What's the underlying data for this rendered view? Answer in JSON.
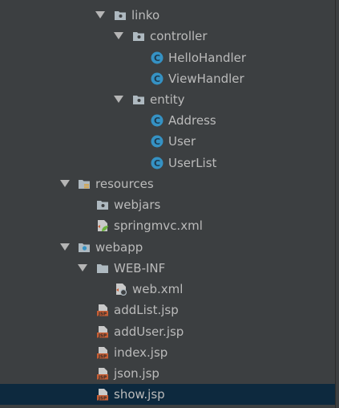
{
  "colors": {
    "background": "#3c3f41",
    "selection": "#0d293e",
    "text": "#bbbbbb",
    "class_icon": "#3592c4",
    "jsp_icon": "#c75e35"
  },
  "tree": {
    "linko": {
      "label": "linko",
      "icon": "package-folder-icon"
    },
    "controller": {
      "label": "controller",
      "icon": "package-folder-icon"
    },
    "hello_handler": {
      "label": "HelloHandler",
      "icon": "class-icon",
      "glyph": "C"
    },
    "view_handler": {
      "label": "ViewHandler",
      "icon": "class-icon",
      "glyph": "C"
    },
    "entity": {
      "label": "entity",
      "icon": "package-folder-icon"
    },
    "address": {
      "label": "Address",
      "icon": "class-icon",
      "glyph": "C"
    },
    "user": {
      "label": "User",
      "icon": "class-icon",
      "glyph": "C"
    },
    "user_list": {
      "label": "UserList",
      "icon": "class-icon",
      "glyph": "C"
    },
    "resources": {
      "label": "resources",
      "icon": "resources-folder-icon"
    },
    "webjars": {
      "label": "webjars",
      "icon": "package-folder-icon"
    },
    "springmvc_xml": {
      "label": "springmvc.xml",
      "icon": "spring-xml-icon"
    },
    "webapp": {
      "label": "webapp",
      "icon": "web-folder-icon"
    },
    "web_inf": {
      "label": "WEB-INF",
      "icon": "folder-icon"
    },
    "web_xml": {
      "label": "web.xml",
      "icon": "web-xml-icon"
    },
    "add_list_jsp": {
      "label": "addList.jsp",
      "icon": "jsp-icon",
      "glyph": "JSP"
    },
    "add_user_jsp": {
      "label": "addUser.jsp",
      "icon": "jsp-icon",
      "glyph": "JSP"
    },
    "index_jsp": {
      "label": "index.jsp",
      "icon": "jsp-icon",
      "glyph": "JSP"
    },
    "json_jsp": {
      "label": "json.jsp",
      "icon": "jsp-icon",
      "glyph": "JSP"
    },
    "show_jsp": {
      "label": "show.jsp",
      "icon": "jsp-icon",
      "glyph": "JSP",
      "selected": true
    }
  }
}
